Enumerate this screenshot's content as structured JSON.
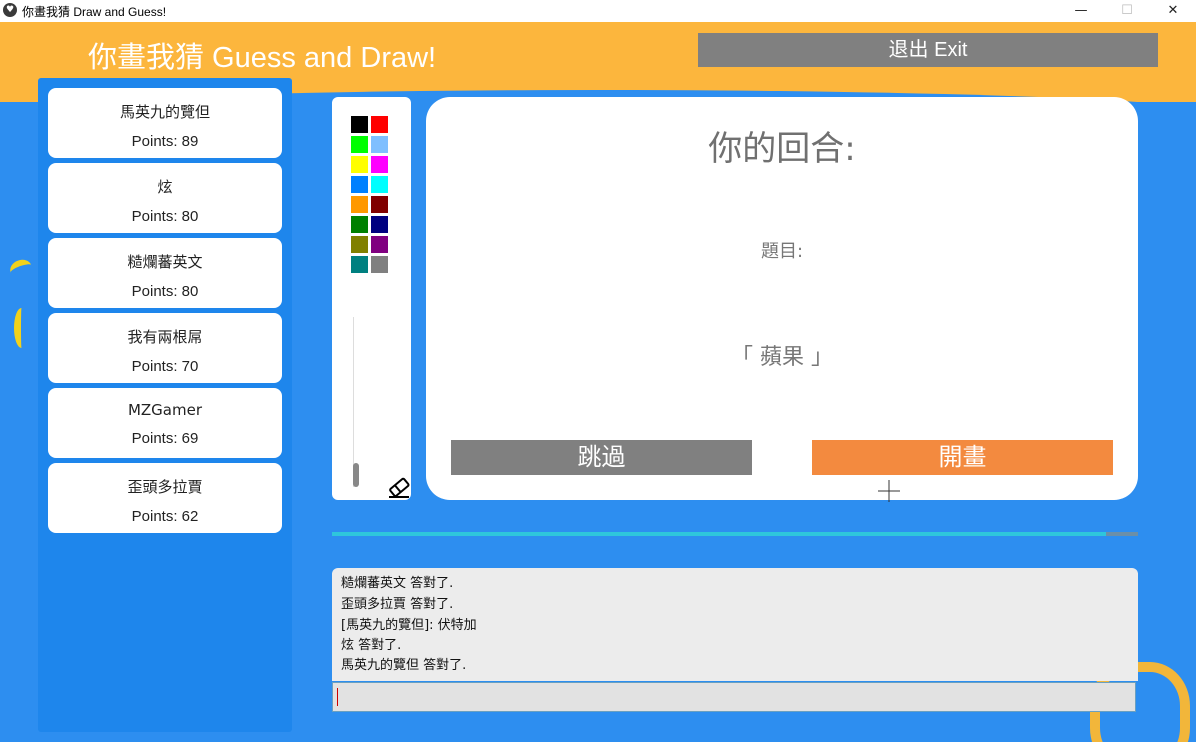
{
  "window": {
    "title": "你畫我猜 Draw and Guess!",
    "minimize": "—",
    "maximize": "☐",
    "close": "✕"
  },
  "header": {
    "title": "你畫我猜 Guess and Draw!",
    "exit_label": "退出 Exit"
  },
  "players": [
    {
      "name": "馬英九的覽但",
      "points": "Points: 89"
    },
    {
      "name": "炫",
      "points": "Points: 80"
    },
    {
      "name": "糙爛蕃英文",
      "points": "Points: 80"
    },
    {
      "name": "我有兩根屌",
      "points": "Points: 70"
    },
    {
      "name": "MZGamer",
      "points": "Points: 69"
    },
    {
      "name": "歪頭多拉賈",
      "points": "Points: 62"
    }
  ],
  "palette": {
    "colors": [
      "#000000",
      "#ff0000",
      "#00ff00",
      "#7fbfff",
      "#ffff00",
      "#ff00ff",
      "#0080ff",
      "#00ffff",
      "#ff9900",
      "#800000",
      "#008000",
      "#000080",
      "#808000",
      "#800080",
      "#008080",
      "#808080"
    ],
    "brush_size_fraction": 0.12
  },
  "turn": {
    "title": "你的回合:",
    "topic_label": "題目:",
    "topic_word": "「 蘋果 」",
    "skip_label": "跳過",
    "start_label": "開畫"
  },
  "timer": {
    "progress": 0.96
  },
  "chat": {
    "lines": [
      "糙爛蕃英文 答對了.",
      "歪頭多拉賈 答對了.",
      "[馬英九的覽但]: 伏特加",
      "炫 答對了.",
      "馬英九的覽但 答對了."
    ],
    "input_value": ""
  }
}
